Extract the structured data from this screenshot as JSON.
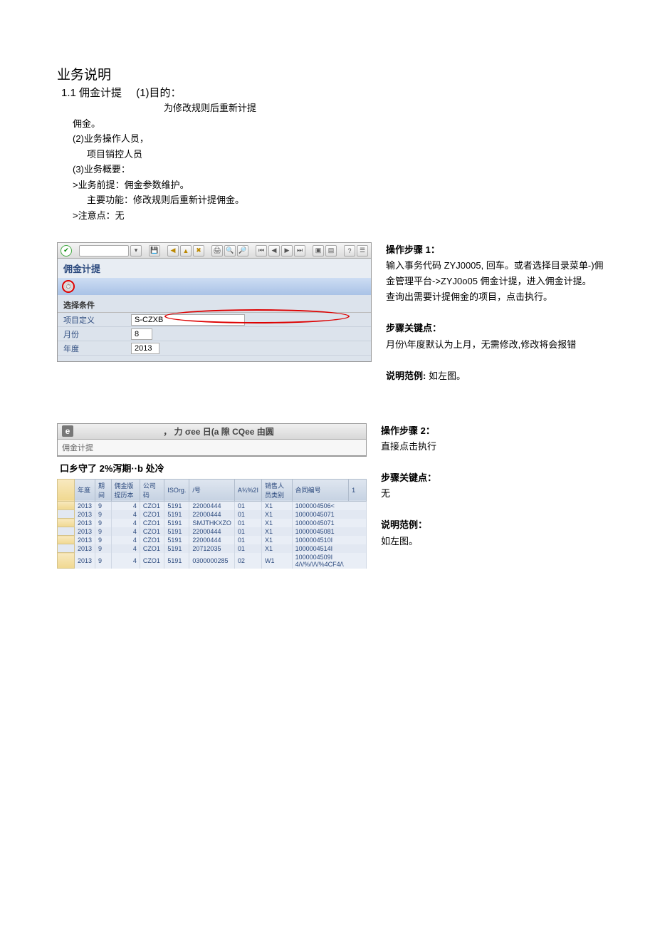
{
  "doc": {
    "title": "业务说明",
    "section_num": "1.1 佣金计提",
    "p1_label": "(1)目的：",
    "p1_text": "为修改规则后重新计提",
    "p1_text2": "佣金。",
    "p2_label": "(2)业务操作人员，",
    "p2_text": "项目销控人员",
    "p3_label": "(3)业务概要：",
    "p3_text1": ">业务前提：佣金参数维护。",
    "p3_text2": "主要功能：修改规则后重新计提佣金。",
    "p3_text3": ">注意点：无"
  },
  "sap1": {
    "title": "佣金计提",
    "section_label": "选择条件",
    "rows": [
      {
        "label": "项目定义",
        "value": "S-CZXB"
      },
      {
        "label": "月份",
        "value": "8"
      },
      {
        "label": "年度",
        "value": "2013"
      }
    ]
  },
  "step1": {
    "heading": "操作步骤 1：",
    "line1": "输入事务代码 ZYJ0005, 回车。或者选择目录菜单-)佣金管理平台->ZYJ0o05 佣金计提，进入佣金计提。",
    "line2": "查询出需要计提佣金的项目，点击执行。",
    "key_heading": "步骤关键点：",
    "key_text": "月份\\年度默认为上月，无需修改,修改将会报错",
    "example_heading": "说明范例:",
    "example_text": "如左图。"
  },
  "sap2": {
    "toolbar_text": "， 力 σee 日(a 隙 CQee 由圆",
    "title": "佣金计提",
    "subtitle": "口乡守了 2%泻期··b 处冷",
    "headers": [
      "",
      "年度",
      "期间",
      "佣金版提历本",
      "公司码",
      "ISOrg.",
      "/号",
      "A¾%2I",
      "销售人员类别",
      "合同编号",
      "1"
    ],
    "rows": [
      {
        "year": "2013",
        "period": "9",
        "ver": "4",
        "co": "CZO1",
        "iso": "5191",
        "no": "22000444",
        "a": "01",
        "sales": "X1",
        "contract": "1000004506<"
      },
      {
        "year": "2013",
        "period": "9",
        "ver": "4",
        "co": "CZO1",
        "iso": "5191",
        "no": "22000444",
        "a": "01",
        "sales": "X1",
        "contract": "10000045071"
      },
      {
        "year": "2013",
        "period": "9",
        "ver": "4",
        "co": "CZO1",
        "iso": "5191",
        "no": "SMJTHKXZO",
        "a": "01",
        "sales": "X1",
        "contract": "10000045071"
      },
      {
        "year": "2013",
        "period": "9",
        "ver": "4",
        "co": "CZO1",
        "iso": "5191",
        "no": "22000444",
        "a": "01",
        "sales": "X1",
        "contract": "10000045081"
      },
      {
        "year": "2013",
        "period": "9",
        "ver": "4",
        "co": "CZO1",
        "iso": "5191",
        "no": "22000444",
        "a": "01",
        "sales": "X1",
        "contract": "1000004510I"
      },
      {
        "year": "2013",
        "period": "9",
        "ver": "4",
        "co": "CZO1",
        "iso": "5191",
        "no": "20712035",
        "a": "01",
        "sales": "X1",
        "contract": "1000004514I"
      },
      {
        "year": "2013",
        "period": "9",
        "ver": "4",
        "co": "CZO1",
        "iso": "5191",
        "no": "0300000285",
        "a": "02",
        "sales": "W1",
        "contract": "1000004509I 4/\\/%/\\/\\/%4CF4/\\"
      }
    ]
  },
  "step2": {
    "heading": "操作步骤 2：",
    "line1": "直接点击执行",
    "key_heading": "步骤关键点：",
    "key_text": "无",
    "example_heading": "说明范例：",
    "example_text": "如左图。"
  }
}
